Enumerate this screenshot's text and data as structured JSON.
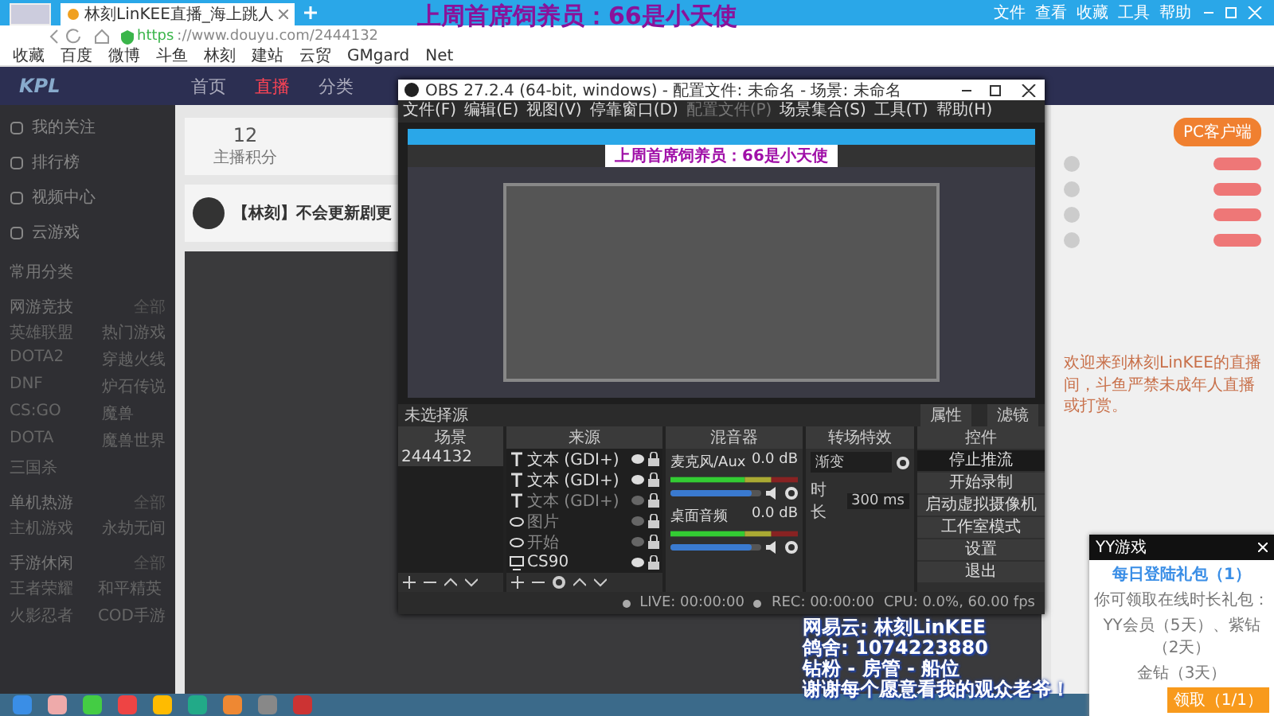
{
  "browser": {
    "tab_title": "林刻LinKEE直播_海上跳人",
    "url_scheme": "https",
    "url": "://www.douyu.com/2444132",
    "menu": [
      "文件",
      "查看",
      "收藏",
      "工具",
      "帮助"
    ],
    "bookmarks": [
      "收藏",
      "百度",
      "微博",
      "斗鱼",
      "林刻",
      "建站",
      "云贸",
      "GMgard",
      "Net"
    ]
  },
  "banner": "上周首席饲养员：66是小天使",
  "site": {
    "nav": [
      {
        "label": "首页",
        "selected": false
      },
      {
        "label": "直播",
        "selected": true
      },
      {
        "label": "分类",
        "selected": false
      }
    ],
    "sidebar": [
      "我的关注",
      "排行榜",
      "视频中心",
      "云游戏"
    ],
    "logo": "KPL",
    "sections": [
      {
        "title": "常用分类"
      },
      {
        "title": "网游竞技",
        "more": "全部",
        "games": [
          "英雄联盟",
          "热门游戏",
          "DOTA2",
          "穿越火线",
          "DNF",
          "炉石传说",
          "CS:GO",
          "魔兽",
          "DOTA",
          "魔兽世界",
          "三国杀"
        ]
      },
      {
        "title": "单机热游",
        "more": "全部",
        "games": [
          "主机游戏",
          "永劫无间"
        ]
      },
      {
        "title": "手游休闲",
        "more": "全部",
        "games": [
          "王者荣耀",
          "和平精英",
          "火影忍者",
          "COD手游"
        ]
      }
    ],
    "stats": {
      "value": "12",
      "label": "主播积分"
    },
    "stream_title": "【林刻】不会更新剧更",
    "pc_button": "PC客户端",
    "notice": "欢迎来到林刻LinKEE的直播间，斗鱼严禁未成年人直播或打赏。"
  },
  "obs": {
    "title": "OBS 27.2.4 (64-bit, windows) - 配置文件: 未命名 - 场景: 未命名",
    "menu": [
      {
        "label": "文件(F)",
        "disabled": false
      },
      {
        "label": "编辑(E)",
        "disabled": false
      },
      {
        "label": "视图(V)",
        "disabled": false
      },
      {
        "label": "停靠窗口(D)",
        "disabled": false
      },
      {
        "label": "配置文件(P)",
        "disabled": true
      },
      {
        "label": "场景集合(S)",
        "disabled": false
      },
      {
        "label": "工具(T)",
        "disabled": false
      },
      {
        "label": "帮助(H)",
        "disabled": false
      }
    ],
    "preview_banner": "上周首席饲养员：66是小天使",
    "source_bar": {
      "label": "未选择源",
      "buttons": [
        "属性",
        "滤镜"
      ]
    },
    "scenes": {
      "title": "场景",
      "items": [
        {
          "label": "2444132",
          "selected": true
        }
      ]
    },
    "sources": {
      "title": "来源",
      "items": [
        {
          "kind": "text",
          "label": "文本 (GDI+)",
          "visible": true,
          "locked": true
        },
        {
          "kind": "text",
          "label": "文本 (GDI+)",
          "visible": true,
          "locked": true
        },
        {
          "kind": "text",
          "label": "文本 (GDI+)",
          "visible": false,
          "locked": true
        },
        {
          "kind": "camera",
          "label": "图片",
          "visible": false,
          "locked": true
        },
        {
          "kind": "camera",
          "label": "开始",
          "visible": false,
          "locked": true
        },
        {
          "kind": "display",
          "label": "CS90",
          "visible": true,
          "locked": true
        }
      ]
    },
    "mixer": {
      "title": "混音器",
      "channels": [
        {
          "name": "麦克风/Aux",
          "reading": "0.0 dB",
          "level": 0.9
        },
        {
          "name": "桌面音频",
          "reading": "0.0 dB",
          "level": 0.9
        }
      ]
    },
    "transitions": {
      "title": "转场特效",
      "type": "渐变",
      "duration_label": "时长",
      "duration": "300 ms"
    },
    "controls": {
      "title": "控件",
      "buttons": [
        "停止推流",
        "开始录制",
        "启动虚拟摄像机",
        "工作室模式",
        "设置",
        "退出"
      ]
    },
    "status": [
      "LIVE: 00:00:00",
      "REC: 00:00:00",
      "CPU: 0.0%, 60.00 fps"
    ]
  },
  "popup": {
    "title": "YY游戏",
    "heading": "每日登陆礼包（1）",
    "lines": [
      "你可领取在线时长礼包：",
      "YY会员（5天）、紫钻（2天）",
      "金钻（3天）"
    ],
    "button": "领取（1/1）"
  },
  "overlay_lines": [
    "网易云: 林刻LinKEE",
    "鸽舍: 1074223880",
    "钻粉 - 房管 - 船位",
    "谢谢每个愿意看我的观众老爷！"
  ]
}
